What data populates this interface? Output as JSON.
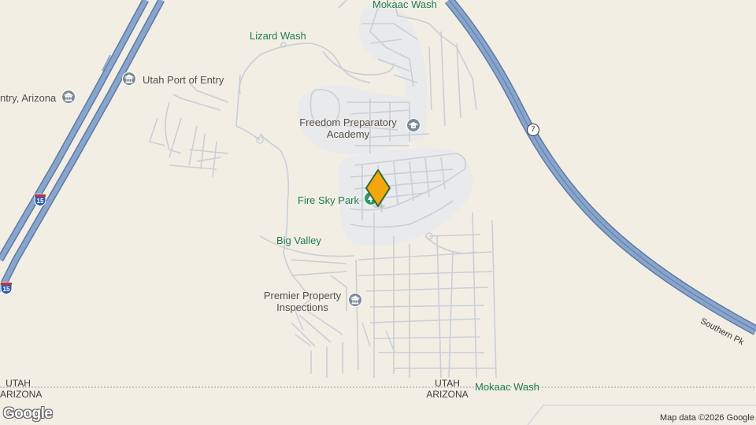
{
  "map": {
    "labels": {
      "mokaac_wash_top": "Mokaac Wash",
      "lizard_wash": "Lizard Wash",
      "utah_port_of_entry": "Utah Port of Entry",
      "entry_arizona": "ntry, Arizona",
      "freedom_preparatory": "Freedom Preparatory Academy",
      "fire_sky_park": "Fire Sky Park",
      "big_valley": "Big Valley",
      "premier_property": "Premier Property Inspections",
      "mokaac_wash_bottom": "Mokaac Wash",
      "southern_pkwy": "Southern Pk"
    },
    "border": {
      "left_top": "UTAH",
      "left_bottom": "ARIZONA",
      "center_top": "UTAH",
      "center_bottom": "ARIZONA"
    },
    "shields": {
      "route7": "7",
      "i15_a": "15",
      "i15_b": "15"
    },
    "icons": {
      "school": "graduation-cap-icon",
      "park": "tree-icon",
      "government": "government-building-icon",
      "business": "business-icon",
      "pin": "location-pin-icon"
    },
    "colors": {
      "land": "#f3eee4",
      "highway": "#7f9bc4",
      "highway_edge": "#5c7aa6",
      "street": "#c9cfd6",
      "poi_green": "#1e7d52",
      "pin": "#f5a60f"
    }
  },
  "attribution": {
    "logo": "Google",
    "map_data": "Map data ©2026 Google"
  }
}
